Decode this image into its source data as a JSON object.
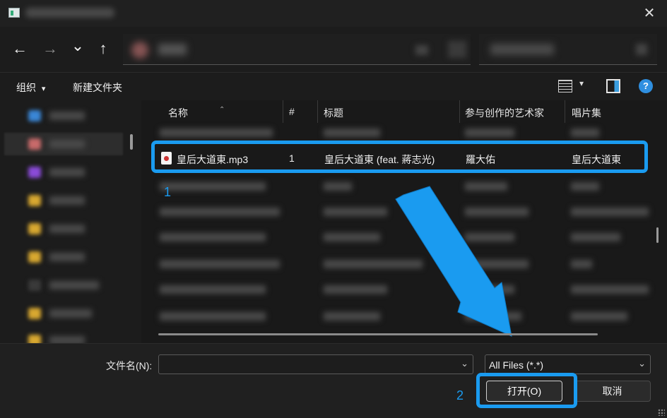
{
  "window": {
    "close_glyph": "✕"
  },
  "nav": {
    "back_glyph": "←",
    "forward_glyph": "→",
    "recent_glyph": "⌄",
    "up_glyph": "↑"
  },
  "toolbar": {
    "organize_label": "组织",
    "organize_chevron": "▾",
    "new_folder_label": "新建文件夹",
    "help_glyph": "?"
  },
  "columns": {
    "name": "名称",
    "number": "#",
    "title": "标题",
    "artists": "参与创作的艺术家",
    "album": "唱片集",
    "sort_glyph": "⌃"
  },
  "selected_file": {
    "name": "皇后大道東.mp3",
    "number": "1",
    "title": "皇后大道東 (feat. 蔣志光)",
    "artist": "羅大佑",
    "album": "皇后大道東"
  },
  "annotations": {
    "step1": "1",
    "step2": "2",
    "accent_color": "#1a9bf0"
  },
  "bottom": {
    "filename_label": "文件名(N):",
    "filename_value": "",
    "filetype_value": "All Files (*.*)",
    "chevron": "⌄",
    "open_label": "打开(O)",
    "cancel_label": "取消"
  }
}
